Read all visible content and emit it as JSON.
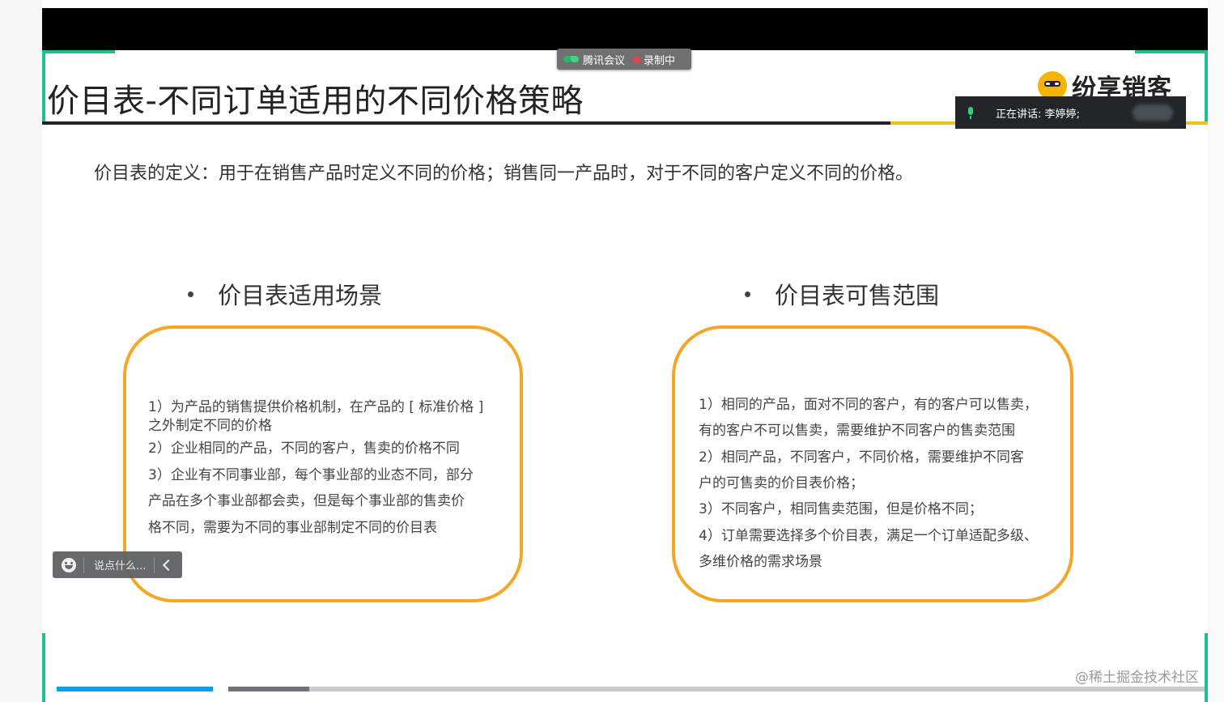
{
  "meeting": {
    "app_name": "腾讯会议",
    "recording_label": "录制中"
  },
  "slide": {
    "title": "价目表-不同订单适用的不同价格策略",
    "brand": "纷享销客",
    "definition": "价目表的定义：用于在销售产品时定义不同的价格；销售同一产品时，对于不同的客户定义不同的价格。",
    "left_section": {
      "heading": "价目表适用场景",
      "lines": [
        "1）为产品的销售提供价格机制，在产品的 [ 标准价格 ]",
        "之外制定不同的价格",
        "2）企业相同的产品，不同的客户，售卖的价格不同",
        "3）企业有不同事业部，每个事业部的业态不同，部分",
        "产品在多个事业部都会卖，但是每个事业部的售卖价",
        "格不同，需要为不同的事业部制定不同的价目表"
      ]
    },
    "right_section": {
      "heading": "价目表可售范围",
      "lines": [
        "1）相同的产品，面对不同的客户，有的客户可以售卖，",
        "有的客户不可以售卖，需要维护不同客户的售卖范围",
        "2）相同产品，不同客户，不同价格，需要维护不同客",
        "户的可售卖的价目表价格；",
        "3）不同客户，相同售卖范围，但是价格不同；",
        "4）订单需要选择多个价目表，满足一个订单适配多级、",
        "多维价格的需求场景"
      ]
    }
  },
  "speaker": {
    "label": "正在讲话: 李婷婷;"
  },
  "chat": {
    "placeholder": "说点什么..."
  },
  "watermark": "@稀土掘金技术社区",
  "colors": {
    "accent_orange": "#f5a624",
    "accent_green": "#1fbf8f",
    "accent_yellow": "#f2c118",
    "progress_blue": "#0aa0e8"
  }
}
